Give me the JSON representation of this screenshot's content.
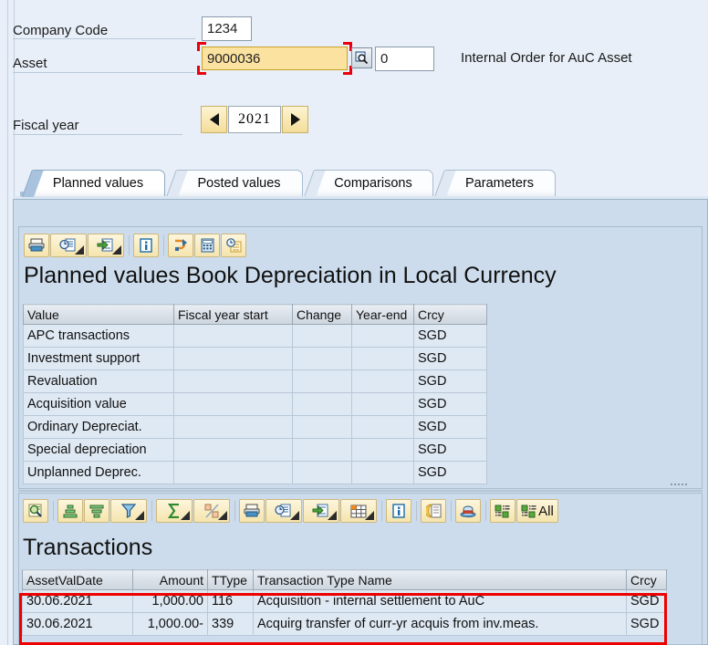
{
  "header": {
    "company_code_label": "Company Code",
    "company_code_value": "1234",
    "asset_label": "Asset",
    "asset_value": "9000036",
    "asset_subnumber_value": "0",
    "asset_description": "Internal Order for AuC Asset",
    "fiscal_year_label": "Fiscal year",
    "fiscal_year_value": "2021",
    "search_help_icon": "search-help-icon",
    "prev_icon": "triangle-left-icon",
    "next_icon": "triangle-right-icon"
  },
  "tabs": [
    {
      "label": "Planned values",
      "active": true
    },
    {
      "label": "Posted values",
      "active": false
    },
    {
      "label": "Comparisons",
      "active": false
    },
    {
      "label": "Parameters",
      "active": false
    }
  ],
  "planned": {
    "title": "Planned values Book Depreciation in Local Currency",
    "toolbar": [
      {
        "name": "print-icon",
        "dropdown": false
      },
      {
        "name": "print-preview-icon",
        "dropdown": true
      },
      {
        "name": "export-icon",
        "dropdown": true
      },
      {
        "name": "separator",
        "dropdown": false
      },
      {
        "name": "info-icon",
        "dropdown": false
      },
      {
        "name": "separator",
        "dropdown": false
      },
      {
        "name": "call-up-icon",
        "dropdown": false
      },
      {
        "name": "calculator-icon",
        "dropdown": false
      },
      {
        "name": "history-icon",
        "dropdown": false
      }
    ],
    "columns": [
      "Value",
      "Fiscal year start",
      "Change",
      "Year-end",
      "Crcy"
    ],
    "rows": [
      {
        "value": "APC transactions",
        "fiscal_year_start": "",
        "change": "",
        "year_end": "",
        "crcy": "SGD",
        "style": "apc"
      },
      {
        "value": "Investment support",
        "fiscal_year_start": "",
        "change": "",
        "year_end": "",
        "crcy": "SGD",
        "style": "normal"
      },
      {
        "value": "Revaluation",
        "fiscal_year_start": "",
        "change": "",
        "year_end": "",
        "crcy": "SGD",
        "style": "normal"
      },
      {
        "value": "Acquisition value",
        "fiscal_year_start": "",
        "change": "",
        "year_end": "",
        "crcy": "SGD",
        "style": "total"
      },
      {
        "value": "Ordinary Depreciat.",
        "fiscal_year_start": "",
        "change": "",
        "year_end": "",
        "crcy": "SGD",
        "style": "normal"
      },
      {
        "value": "Special depreciation",
        "fiscal_year_start": "",
        "change": "",
        "year_end": "",
        "crcy": "SGD",
        "style": "normal"
      },
      {
        "value": "Unplanned Deprec.",
        "fiscal_year_start": "",
        "change": "",
        "year_end": "",
        "crcy": "SGD",
        "style": "normal"
      }
    ]
  },
  "transactions": {
    "title": "Transactions",
    "toolbar": [
      {
        "name": "details-magnifier-icon",
        "dropdown": false
      },
      {
        "name": "separator",
        "dropdown": false
      },
      {
        "name": "sort-ascending-icon",
        "dropdown": false
      },
      {
        "name": "sort-descending-icon",
        "dropdown": false
      },
      {
        "name": "filter-icon",
        "dropdown": true
      },
      {
        "name": "separator",
        "dropdown": false
      },
      {
        "name": "total-sum-icon",
        "dropdown": true
      },
      {
        "name": "subtotal-icon",
        "dropdown": true
      },
      {
        "name": "separator",
        "dropdown": false
      },
      {
        "name": "print-icon",
        "dropdown": false
      },
      {
        "name": "print-preview-icon",
        "dropdown": true
      },
      {
        "name": "export-icon",
        "dropdown": true
      },
      {
        "name": "layout-icon",
        "dropdown": true
      },
      {
        "name": "separator",
        "dropdown": false
      },
      {
        "name": "info-icon",
        "dropdown": false
      },
      {
        "name": "separator",
        "dropdown": false
      },
      {
        "name": "select-layout-icon",
        "dropdown": false
      },
      {
        "name": "separator",
        "dropdown": false
      },
      {
        "name": "graphic-icon",
        "dropdown": false
      },
      {
        "name": "separator",
        "dropdown": false
      },
      {
        "name": "select-all-detail-icon",
        "dropdown": false
      },
      {
        "name": "select-all-icon",
        "dropdown": false,
        "label": "All"
      }
    ],
    "columns": [
      "AssetValDate",
      "Amount",
      "TType",
      "Transaction Type Name",
      "Crcy"
    ],
    "rows": [
      {
        "asset_val_date": "30.06.2021",
        "amount": "1,000.00",
        "ttype": "116",
        "transaction_type_name": "Acquisition - internal settlement to AuC",
        "crcy": "SGD",
        "date_cell_style": "orange"
      },
      {
        "asset_val_date": "30.06.2021",
        "amount": "1,000.00-",
        "ttype": "339",
        "transaction_type_name": "Acquirg transfer of curr-yr acquis from inv.meas.",
        "crcy": "SGD",
        "date_cell_style": "cyan"
      }
    ]
  },
  "colors": {
    "background": "#e8eff8",
    "panel": "#ccdcec",
    "focus_red": "#ee0000",
    "field_focus_yellow": "#fbe2a0",
    "label_cyan": "#9fe4f5",
    "selected_orange": "#fbcf87",
    "total_yellow": "#ffef21",
    "year_end_green": "#c6f3c0"
  }
}
